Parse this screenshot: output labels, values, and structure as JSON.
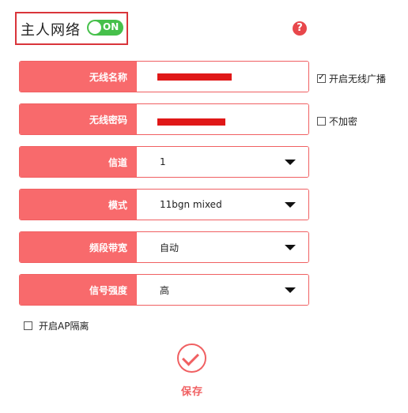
{
  "header": {
    "title": "主人网络",
    "toggle_label": "ON",
    "help_label": "?"
  },
  "colors": {
    "accent": "#f86a6c",
    "toggle_on": "#46c04b",
    "highlight_border": "#d9353b"
  },
  "fields": {
    "ssid": {
      "label": "无线名称",
      "value": ""
    },
    "password": {
      "label": "无线密码",
      "value": ""
    },
    "channel": {
      "label": "信道",
      "value": "1"
    },
    "mode": {
      "label": "模式",
      "value": "11bgn mixed"
    },
    "bandwidth": {
      "label": "频段带宽",
      "value": "自动"
    },
    "signal": {
      "label": "信号强度",
      "value": "高"
    }
  },
  "options": {
    "broadcast": {
      "label": "开启无线广播",
      "checked": true
    },
    "no_encrypt": {
      "label": "不加密",
      "checked": false
    },
    "ap_isolation": {
      "label": "开启AP隔离",
      "checked": false
    }
  },
  "save": {
    "label": "保存"
  }
}
